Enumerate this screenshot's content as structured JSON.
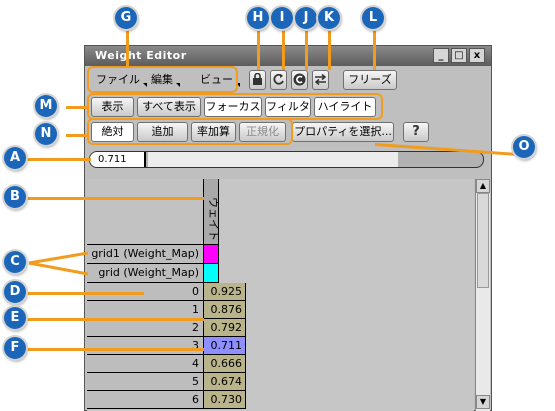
{
  "window": {
    "title": "Weight Editor",
    "btn_min": "_",
    "btn_max": "□",
    "btn_close": "x"
  },
  "menus": {
    "file": "ファイル",
    "edit": "編集",
    "view": "ビュー"
  },
  "toolbar": {
    "freeze": "フリーズ"
  },
  "filter_bar": {
    "show": "表示",
    "show_all": "すべて表示",
    "focus": "フォーカス",
    "filter": "フィルタ",
    "highlight": "ハイライト"
  },
  "mode_bar": {
    "absolute": "絶対",
    "add": "追加",
    "add_percent": "率加算",
    "normalize": "正規化",
    "select_property": "プロパティを選択...",
    "help": "?"
  },
  "value_field": {
    "value": "0.711"
  },
  "grid": {
    "column_header": "ウェイト",
    "maps": [
      {
        "label": "grid1 (Weight_Map)",
        "color": "#ff00ff"
      },
      {
        "label": "grid (Weight_Map)",
        "color": "#00ffff"
      }
    ],
    "rows": [
      {
        "index": "0",
        "value": "0.925"
      },
      {
        "index": "1",
        "value": "0.876"
      },
      {
        "index": "2",
        "value": "0.792"
      },
      {
        "index": "3",
        "value": "0.711"
      },
      {
        "index": "4",
        "value": "0.666"
      },
      {
        "index": "5",
        "value": "0.674"
      },
      {
        "index": "6",
        "value": "0.730"
      }
    ]
  },
  "callouts": {
    "a": "A",
    "b": "B",
    "c": "C",
    "d": "D",
    "e": "E",
    "f": "F",
    "g": "G",
    "h": "H",
    "i": "I",
    "j": "J",
    "k": "K",
    "l": "L",
    "m": "M",
    "n": "N",
    "o": "O"
  },
  "colors": {
    "callout": "#1c66b9",
    "leader": "#f29c1f",
    "value_cell": "#b9b48a",
    "selected_cell": "#8f8fff"
  }
}
